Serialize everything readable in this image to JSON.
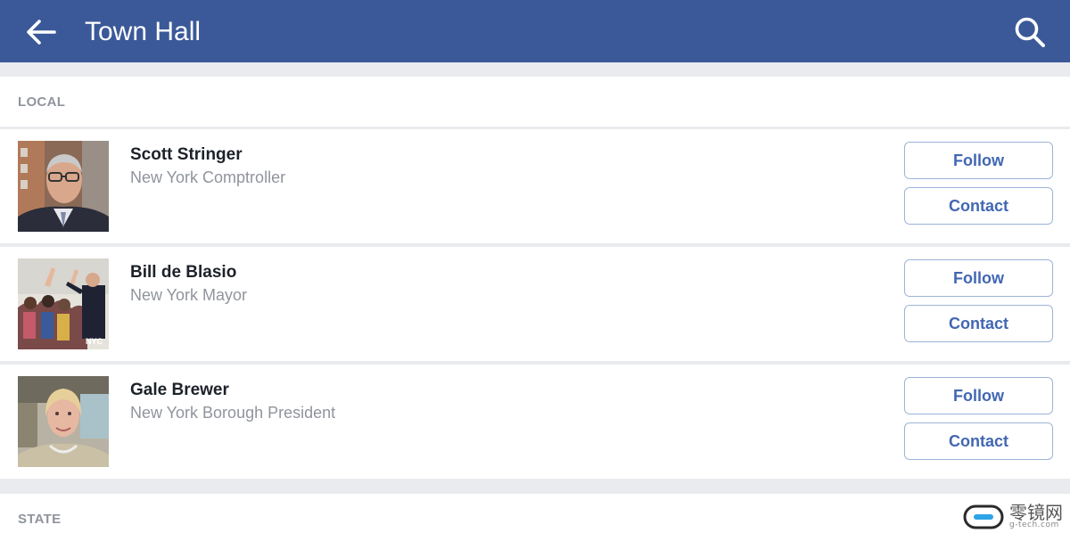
{
  "topbar": {
    "back_icon": "arrow-left-icon",
    "title": "Town Hall",
    "search_icon": "search-icon",
    "color": "#3b5998"
  },
  "sections": {
    "local": {
      "label": "LOCAL"
    },
    "state": {
      "label": "STATE"
    }
  },
  "officials": [
    {
      "name": "Scott Stringer",
      "role": "New York Comptroller",
      "follow_label": "Follow",
      "contact_label": "Contact"
    },
    {
      "name": "Bill de Blasio",
      "role": "New York Mayor",
      "follow_label": "Follow",
      "contact_label": "Contact"
    },
    {
      "name": "Gale Brewer",
      "role": "New York Borough President",
      "follow_label": "Follow",
      "contact_label": "Contact"
    }
  ],
  "watermark": {
    "main": "零镜网",
    "sub": "g-tech.com"
  },
  "colors": {
    "accent": "#4267b2",
    "button_border": "#9cb4d8",
    "secondary_text": "#90949c",
    "background": "#e9ebee"
  }
}
